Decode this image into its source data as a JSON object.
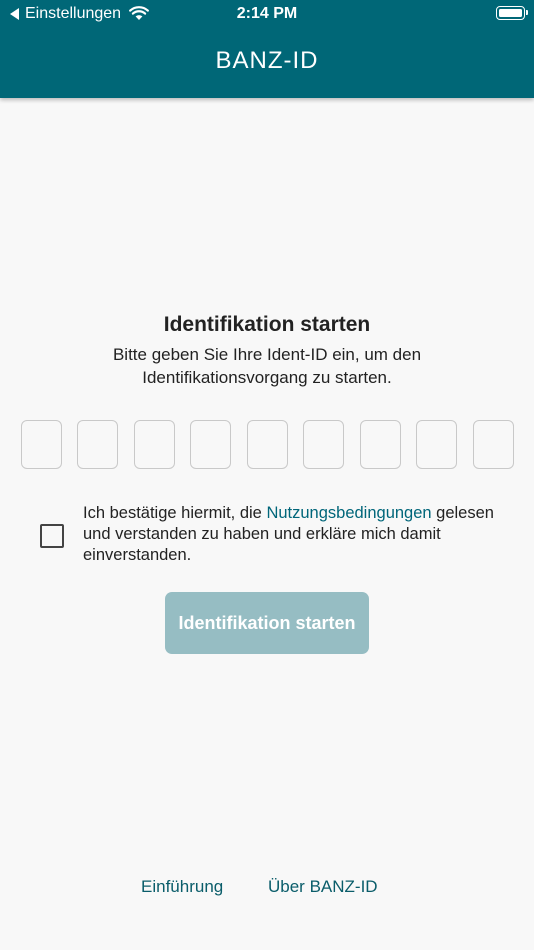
{
  "status_bar": {
    "carrier": "Einstellungen",
    "time": "2:14 PM"
  },
  "header": {
    "title": "BANZ-ID",
    "background_color": "#006777"
  },
  "main": {
    "heading": "Identifikation starten",
    "subtitle": "Bitte geben Sie Ihre Ident-ID ein, um den Identifikationsvorgang zu starten.",
    "code_input_boxes": [
      "",
      "",
      "",
      "",
      "",
      "",
      "",
      "",
      ""
    ],
    "terms": {
      "checked": false,
      "prefix": "Ich bestätige hiermit, die ",
      "link": "Nutzungsbedingungen",
      "suffix": " gelesen und verstanden zu haben und erkläre mich damit einverstanden."
    },
    "start_button": {
      "label": "Identifikation starten",
      "enabled": false,
      "color": "#96bdc3"
    }
  },
  "footer": {
    "links": [
      "Einführung",
      "Über BANZ-ID"
    ]
  },
  "icons": [
    "back-arrow-icon",
    "wifi-icon",
    "battery-icon"
  ]
}
